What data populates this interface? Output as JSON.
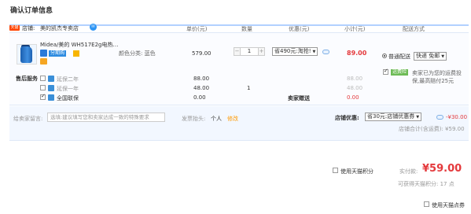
{
  "page_title": "确认订单信息",
  "columns": {
    "unit_price": "单价(元)",
    "quantity": "数量",
    "promo": "优惠(元)",
    "subtotal": "小计(元)",
    "shipping": "配送方式"
  },
  "shop": {
    "badge": "天猫",
    "label": "店铺:",
    "name": "美的凯杰专卖店"
  },
  "product": {
    "name": "Midea/美的 WH517E2g电热…",
    "jifen_tag": "分期购",
    "attr": "颜色分类: 蓝色",
    "price": "579.00",
    "qty": "1",
    "promo_select": "省490元:淘抢!",
    "subtotal": "89.00"
  },
  "shipping": {
    "method_label": "普通配送",
    "method_select": "快递 免邮",
    "insurance_badge": "运费险",
    "insurance_text": "卖家已为您的运费投保,最高赔付25元"
  },
  "after_sales": {
    "title": "售后服务",
    "items": [
      {
        "name": "延保二年",
        "price": "88.00",
        "qty": "",
        "subtotal": "88.00",
        "checked": false
      },
      {
        "name": "延保一年",
        "price": "48.00",
        "qty": "1",
        "subtotal": "48.00",
        "checked": false
      },
      {
        "name": "全国联保",
        "price": "0.00",
        "qty": "",
        "subtotal": "0.00",
        "checked": true
      }
    ],
    "note": "卖家赠送"
  },
  "message": {
    "label": "给卖家留言:",
    "placeholder": "选填:建议填写您和卖家达成一致的特殊要求"
  },
  "invoice": {
    "label": "发票抬头:",
    "value": "个人",
    "edit": "修改"
  },
  "shop_coupon": {
    "label": "店铺优惠:",
    "select": "省30元:店铺优惠券",
    "value": "-¥30.00"
  },
  "shop_total": "店铺合计(含运费): ¥59.00",
  "payment": {
    "use_points_label": "使用天猫积分",
    "real_pay_label": "实付款:",
    "real_pay_value": "¥59.00",
    "points_earned": "可获得天猫积分: 17 点",
    "coupon_label": "使用天猫点券"
  },
  "colors": {
    "accent_red": "#e4393c",
    "header_line": "#b2d1ff",
    "tag_blue": "#2a7ad8"
  }
}
